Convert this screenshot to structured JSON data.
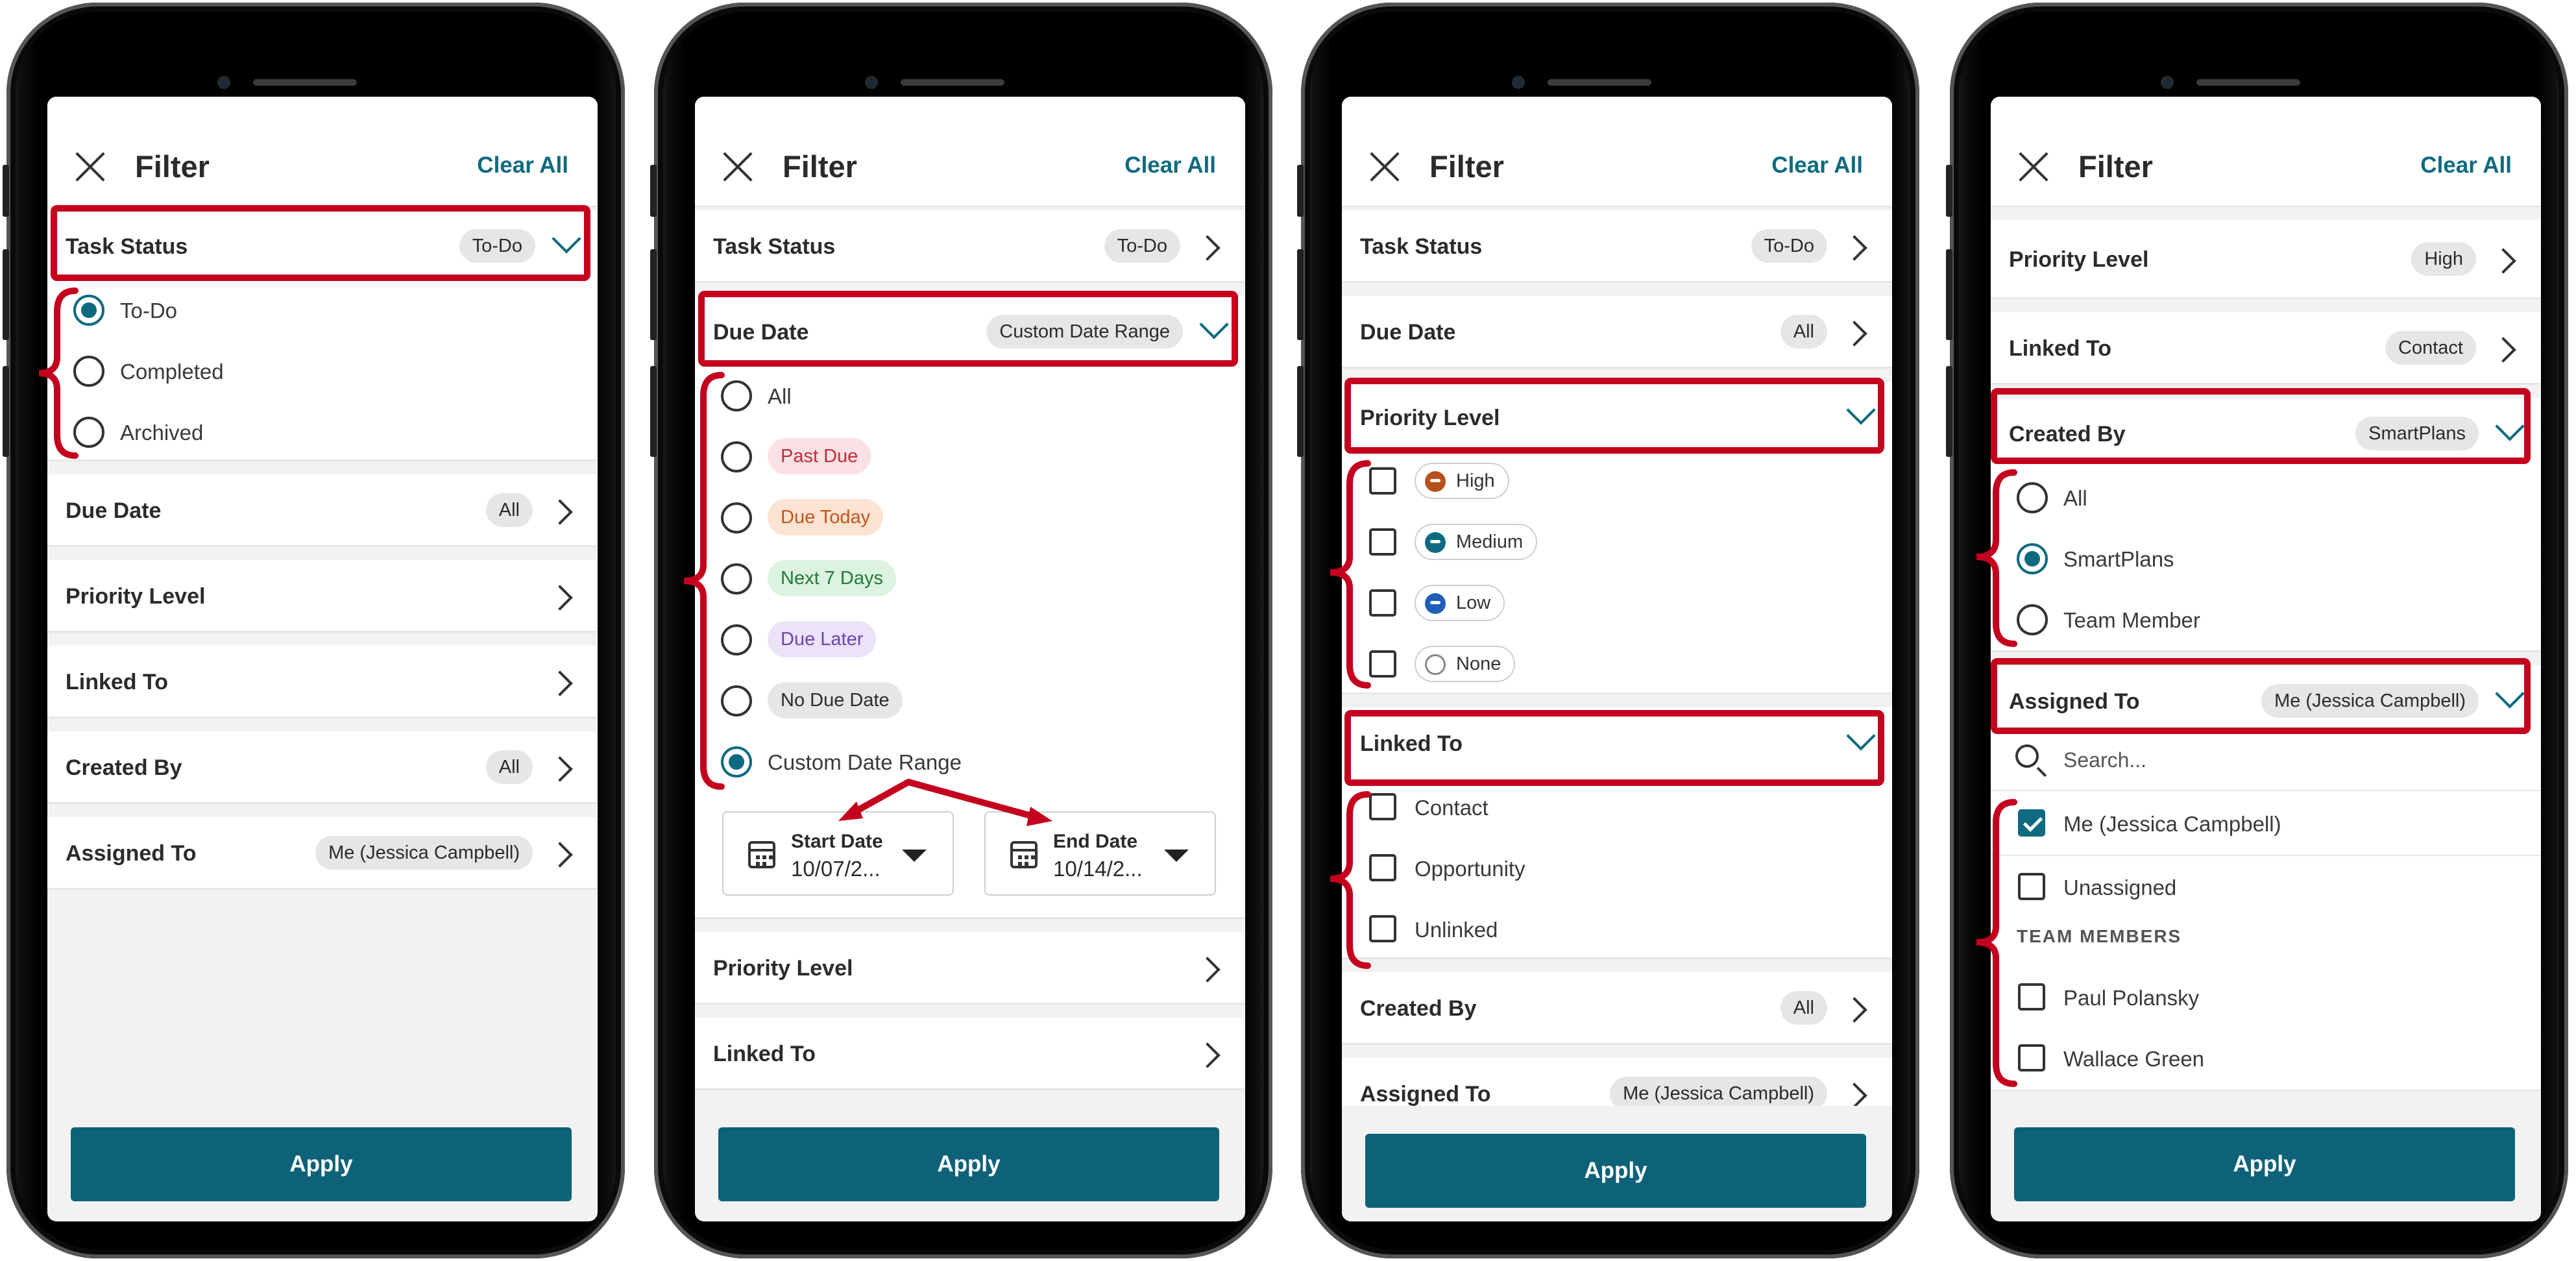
{
  "header": {
    "title": "Filter",
    "clear_all": "Clear All"
  },
  "apply_label": "Apply",
  "screens": [
    {
      "task_status": {
        "label": "Task Status",
        "value": "To-Do"
      },
      "task_status_options": [
        "To-Do",
        "Completed",
        "Archived"
      ],
      "due_date": {
        "label": "Due Date",
        "value": "All"
      },
      "priority_level": {
        "label": "Priority Level"
      },
      "linked_to": {
        "label": "Linked To"
      },
      "created_by": {
        "label": "Created By",
        "value": "All"
      },
      "assigned_to": {
        "label": "Assigned To",
        "value": "Me (Jessica Campbell)"
      }
    },
    {
      "task_status": {
        "label": "Task Status",
        "value": "To-Do"
      },
      "due_date": {
        "label": "Due Date",
        "value": "Custom Date Range"
      },
      "due_date_options": [
        "All",
        "Past Due",
        "Due Today",
        "Next 7 Days",
        "Due Later",
        "No Due Date",
        "Custom Date Range"
      ],
      "start_date": {
        "label": "Start Date",
        "value": "10/07/2..."
      },
      "end_date": {
        "label": "End Date",
        "value": "10/14/2..."
      },
      "priority_level": {
        "label": "Priority Level"
      },
      "linked_to": {
        "label": "Linked To"
      }
    },
    {
      "task_status": {
        "label": "Task Status",
        "value": "To-Do"
      },
      "due_date": {
        "label": "Due Date",
        "value": "All"
      },
      "priority_level": {
        "label": "Priority Level"
      },
      "priority_options": [
        "High",
        "Medium",
        "Low",
        "None"
      ],
      "linked_to": {
        "label": "Linked To"
      },
      "linked_options": [
        "Contact",
        "Opportunity",
        "Unlinked"
      ],
      "created_by": {
        "label": "Created By",
        "value": "All"
      },
      "assigned_to": {
        "label": "Assigned To",
        "value": "Me (Jessica Campbell)"
      }
    },
    {
      "priority_level": {
        "label": "Priority Level",
        "value": "High"
      },
      "linked_to": {
        "label": "Linked To",
        "value": "Contact"
      },
      "created_by": {
        "label": "Created By",
        "value": "SmartPlans"
      },
      "created_by_options": [
        "All",
        "SmartPlans",
        "Team Member"
      ],
      "assigned_to": {
        "label": "Assigned To",
        "value": "Me (Jessica Campbell)"
      },
      "search_placeholder": "Search...",
      "assigned_options": [
        "Me (Jessica Campbell)",
        "Unassigned"
      ],
      "team_members_header": "TEAM MEMBERS",
      "team_members": [
        "Paul Polansky",
        "Wallace Green"
      ]
    }
  ],
  "colors": {
    "accent": "#0e6a80",
    "apply_button": "#0d6278",
    "annotation_red": "#c4001e",
    "past_due": "#c42b3c",
    "due_today": "#c2561b",
    "next_7_days": "#1f7a3a",
    "due_later": "#6d43b5",
    "priority_high": "#b8501c",
    "priority_medium": "#0e6a80",
    "priority_low": "#1f5fb8"
  }
}
